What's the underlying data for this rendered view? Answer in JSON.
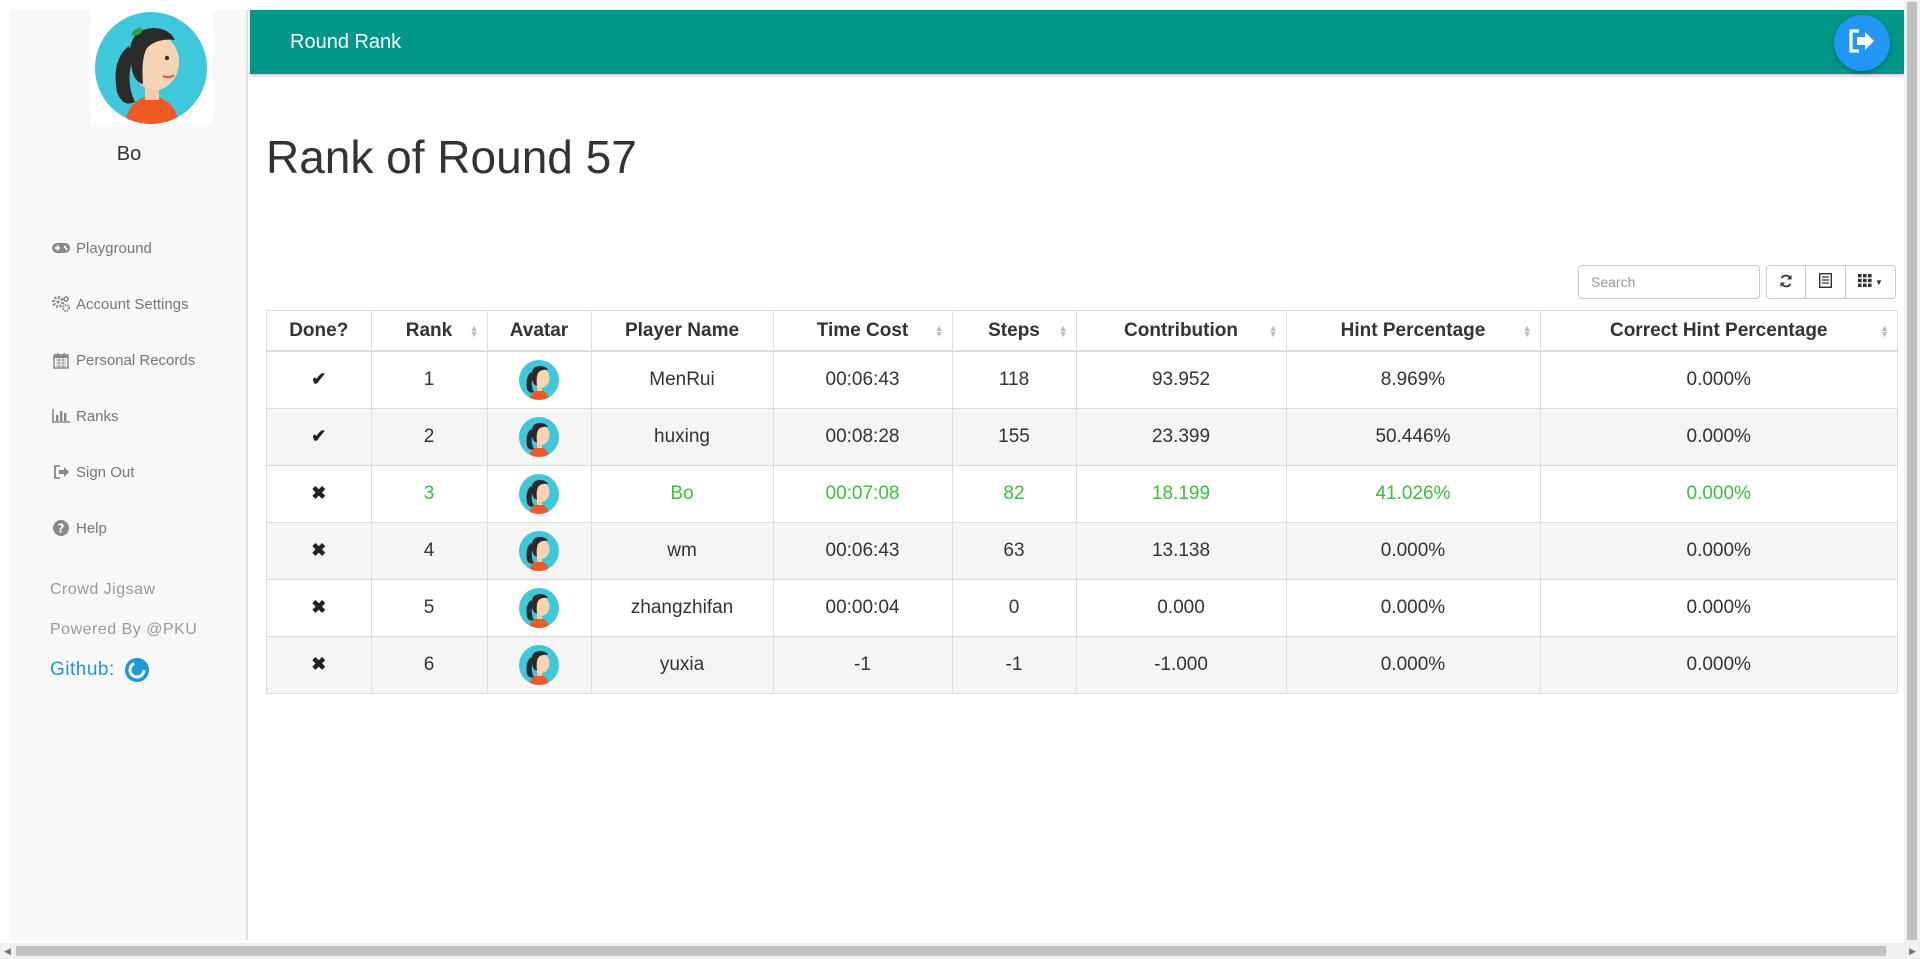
{
  "user": {
    "name": "Bo"
  },
  "nav": [
    {
      "label": "Playground",
      "icon": "gamepad-icon"
    },
    {
      "label": "Account Settings",
      "icon": "gears-icon"
    },
    {
      "label": "Personal Records",
      "icon": "calendar-icon"
    },
    {
      "label": "Ranks",
      "icon": "bar-chart-icon"
    },
    {
      "label": "Sign Out",
      "icon": "sign-out-icon"
    },
    {
      "label": "Help",
      "icon": "question-icon"
    }
  ],
  "footer": {
    "app_name": "Crowd Jigsaw",
    "powered": "Powered By @PKU",
    "github": "Github:"
  },
  "header": {
    "title": "Round Rank"
  },
  "page": {
    "title": "Rank of Round 57"
  },
  "toolbar": {
    "search_placeholder": "Search"
  },
  "table": {
    "columns": [
      "Done?",
      "Rank",
      "Avatar",
      "Player Name",
      "Time Cost",
      "Steps",
      "Contribution",
      "Hint Percentage",
      "Correct Hint Percentage"
    ],
    "rows": [
      {
        "done": "✔",
        "rank": "1",
        "name": "MenRui",
        "time": "00:06:43",
        "steps": "118",
        "contribution": "93.952",
        "hint": "8.969%",
        "correct": "0.000%"
      },
      {
        "done": "✔",
        "rank": "2",
        "name": "huxing",
        "time": "00:08:28",
        "steps": "155",
        "contribution": "23.399",
        "hint": "50.446%",
        "correct": "0.000%"
      },
      {
        "done": "✖",
        "rank": "3",
        "name": "Bo",
        "time": "00:07:08",
        "steps": "82",
        "contribution": "18.199",
        "hint": "41.026%",
        "correct": "0.000%"
      },
      {
        "done": "✖",
        "rank": "4",
        "name": "wm",
        "time": "00:06:43",
        "steps": "63",
        "contribution": "13.138",
        "hint": "0.000%",
        "correct": "0.000%"
      },
      {
        "done": "✖",
        "rank": "5",
        "name": "zhangzhifan",
        "time": "00:00:04",
        "steps": "0",
        "contribution": "0.000",
        "hint": "0.000%",
        "correct": "0.000%"
      },
      {
        "done": "✖",
        "rank": "6",
        "name": "yuxia",
        "time": "-1",
        "steps": "-1",
        "contribution": "-1.000",
        "hint": "0.000%",
        "correct": "0.000%"
      }
    ]
  },
  "colors": {
    "header": "#009688",
    "logout": "#2196f3",
    "highlight": "#3bbf3b",
    "link": "#1a9ad6"
  }
}
